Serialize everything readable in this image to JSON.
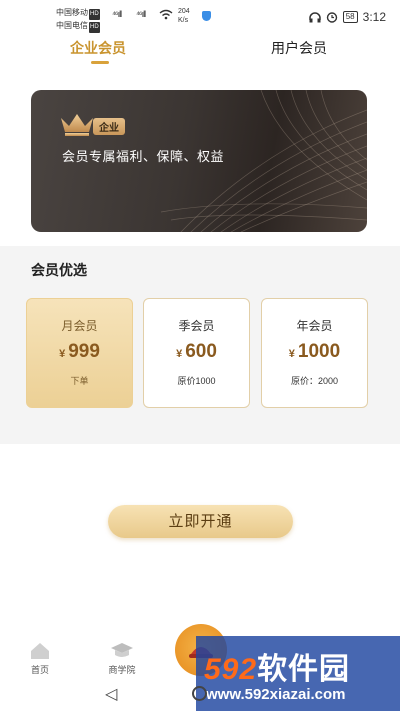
{
  "status_bar": {
    "carrier1": "中国移动",
    "carrier2": "中国电信",
    "hd": "HD",
    "signal1": "⁴⁶ıll",
    "signal2": "⁴⁶ıll",
    "speed_value": "204",
    "speed_unit": "K/s",
    "battery": "58",
    "time": "3:12"
  },
  "tabs": {
    "enterprise": "企业会员",
    "user": "用户会员",
    "active": "enterprise"
  },
  "banner": {
    "badge": "企业",
    "text": "会员专属福利、保障、权益"
  },
  "plans_section": {
    "title": "会员优选",
    "plans": [
      {
        "name": "月会员",
        "currency": "¥",
        "price": "999",
        "sub": "下单",
        "selected": true
      },
      {
        "name": "季会员",
        "currency": "¥",
        "price": "600",
        "sub": "原价1000",
        "selected": false
      },
      {
        "name": "年会员",
        "currency": "¥",
        "price": "1000",
        "sub": "原价：2000",
        "selected": false
      }
    ]
  },
  "activate_button": "立即开通",
  "bottom_nav": {
    "items": [
      {
        "label": "首页"
      },
      {
        "label": "商学院"
      }
    ]
  },
  "watermark": {
    "logo_num": "592",
    "logo_cn": "软件园",
    "url": "www.592xiazai.com"
  },
  "colors": {
    "accent": "#c9942f",
    "banner_bg": "#3b3532",
    "plan_selected": "#ecd095",
    "button": "#e8c98a"
  }
}
